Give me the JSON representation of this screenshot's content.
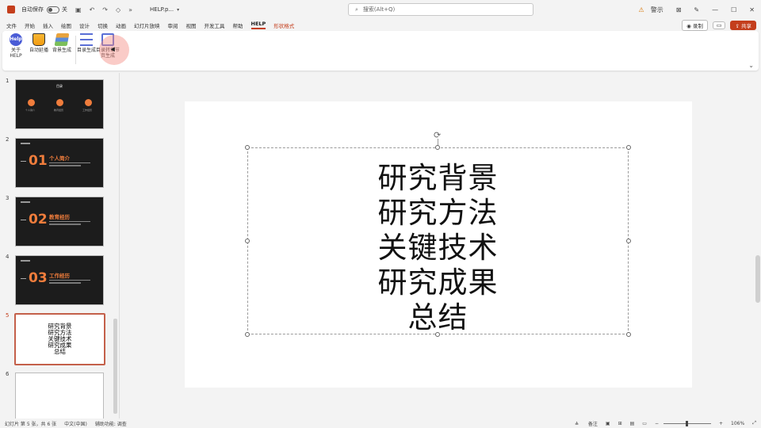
{
  "titlebar": {
    "autosave_label": "自动保存",
    "autosave_state": "关",
    "filename": "HELP.p...",
    "search_placeholder": "搜索(Alt+Q)",
    "warning_label": "警示"
  },
  "menu": {
    "tabs": [
      "文件",
      "开始",
      "插入",
      "绘图",
      "设计",
      "切换",
      "动画",
      "幻灯片放映",
      "审阅",
      "视图",
      "开发工具",
      "帮助",
      "HELP",
      "形状格式"
    ],
    "active_tab": "HELP",
    "present_label": "录制",
    "share_label": "共享"
  },
  "ribbon": {
    "buttons": [
      {
        "label": "关于 HELP",
        "icon": "help-logo-icon"
      },
      {
        "label": "自动延播",
        "icon": "cup-icon"
      },
      {
        "label": "背景生成",
        "icon": "layers-icon"
      },
      {
        "label": "目录生成",
        "icon": "list-lines-icon"
      },
      {
        "label": "目录转章节页生成",
        "icon": "frame-icon"
      }
    ]
  },
  "thumbnails": [
    {
      "num": "1",
      "title": "目录",
      "items": [
        "个人简介",
        "教育经历",
        "工作经历"
      ]
    },
    {
      "num": "2",
      "big": "01",
      "title": "个人简介"
    },
    {
      "num": "3",
      "big": "02",
      "title": "教育经历"
    },
    {
      "num": "4",
      "big": "03",
      "title": "工作经历"
    },
    {
      "num": "5",
      "text": [
        "研究背景",
        "研究方法",
        "关键技术",
        "研究成果",
        "总结"
      ]
    },
    {
      "num": "6"
    }
  ],
  "slide": {
    "lines": [
      "研究背景",
      "研究方法",
      "关键技术",
      "研究成果",
      "总结"
    ]
  },
  "status": {
    "slide_info": "幻灯片 第 5 张，共 6 张",
    "language": "中文(中国)",
    "accessibility": "辅助功能: 调查",
    "notes_label": "备注",
    "zoom": "106%"
  },
  "colors": {
    "accent": "#c43e1c",
    "thumb_orange": "#f07d3c"
  }
}
